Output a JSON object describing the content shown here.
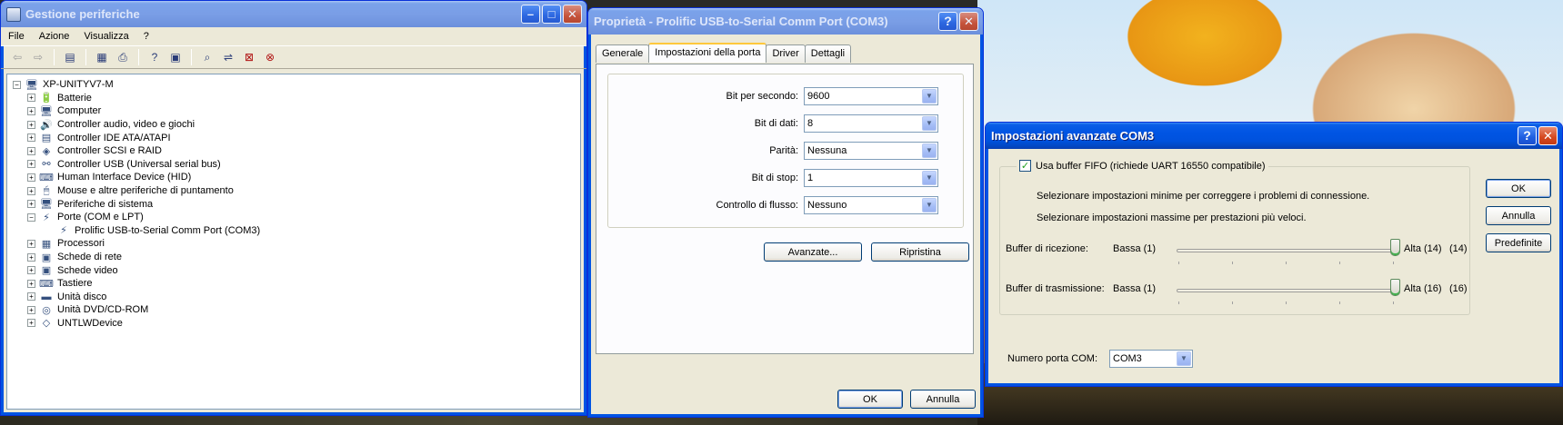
{
  "device_manager": {
    "title": "Gestione periferiche",
    "menu": [
      "File",
      "Azione",
      "Visualizza",
      "?"
    ],
    "toolbar_icons": [
      "back-arrow-icon",
      "forward-arrow-icon",
      "show-view-icon",
      "properties-icon",
      "print-icon",
      "help-icon",
      "view-icon",
      "scan-hardware-icon",
      "update-driver-icon",
      "disable-device-icon",
      "uninstall-device-icon"
    ],
    "tree": {
      "root": "XP-UNITYV7-M",
      "categories": [
        {
          "label": "Batterie",
          "icon": "🔋",
          "expanded": false
        },
        {
          "label": "Computer",
          "icon": "🖥",
          "expanded": false
        },
        {
          "label": "Controller audio, video e giochi",
          "icon": "🔊",
          "expanded": false
        },
        {
          "label": "Controller IDE ATA/ATAPI",
          "icon": "▤",
          "expanded": false
        },
        {
          "label": "Controller SCSI e RAID",
          "icon": "◈",
          "expanded": false
        },
        {
          "label": "Controller USB (Universal serial bus)",
          "icon": "⚯",
          "expanded": false
        },
        {
          "label": "Human Interface Device (HID)",
          "icon": "⌨",
          "expanded": false
        },
        {
          "label": "Mouse e altre periferiche di puntamento",
          "icon": "🖱",
          "expanded": false
        },
        {
          "label": "Periferiche di sistema",
          "icon": "🖥",
          "expanded": false
        },
        {
          "label": "Porte (COM e LPT)",
          "icon": "⚡",
          "expanded": true,
          "children": [
            "Prolific USB-to-Serial Comm Port (COM3)"
          ]
        },
        {
          "label": "Processori",
          "icon": "▦",
          "expanded": false
        },
        {
          "label": "Schede di rete",
          "icon": "▣",
          "expanded": false
        },
        {
          "label": "Schede video",
          "icon": "▣",
          "expanded": false
        },
        {
          "label": "Tastiere",
          "icon": "⌨",
          "expanded": false
        },
        {
          "label": "Unità disco",
          "icon": "▬",
          "expanded": false
        },
        {
          "label": "Unità DVD/CD-ROM",
          "icon": "◎",
          "expanded": false
        },
        {
          "label": "UNTLWDevice",
          "icon": "◇",
          "expanded": false
        }
      ]
    }
  },
  "properties": {
    "title": "Proprietà - Prolific USB-to-Serial Comm Port (COM3)",
    "tabs": [
      "Generale",
      "Impostazioni della porta",
      "Driver",
      "Dettagli"
    ],
    "active_tab": 1,
    "fields": [
      {
        "label": "Bit per secondo:",
        "value": "9600"
      },
      {
        "label": "Bit di dati:",
        "value": "8"
      },
      {
        "label": "Parità:",
        "value": "Nessuna"
      },
      {
        "label": "Bit di stop:",
        "value": "1"
      },
      {
        "label": "Controllo di flusso:",
        "value": "Nessuno"
      }
    ],
    "advanced_button": "Avanzate...",
    "restore_button": "Ripristina",
    "ok_button": "OK",
    "cancel_button": "Annulla"
  },
  "advanced": {
    "title": "Impostazioni avanzate COM3",
    "fifo_checkbox": "Usa buffer FIFO (richiede UART 16550 compatibile)",
    "fifo_checked": true,
    "hint_min": "Selezionare impostazioni minime per correggere i problemi di connessione.",
    "hint_max": "Selezionare impostazioni massime per prestazioni più veloci.",
    "receive": {
      "label": "Buffer di ricezione:",
      "low": "Bassa (1)",
      "high": "Alta (14)",
      "value": "(14)",
      "level": 1.0
    },
    "transmit": {
      "label": "Buffer di trasmissione:",
      "low": "Bassa (1)",
      "high": "Alta (16)",
      "value": "(16)",
      "level": 1.0
    },
    "com_port_label": "Numero porta COM:",
    "com_port_value": "COM3",
    "ok_button": "OK",
    "cancel_button": "Annulla",
    "defaults_button": "Predefinite"
  }
}
